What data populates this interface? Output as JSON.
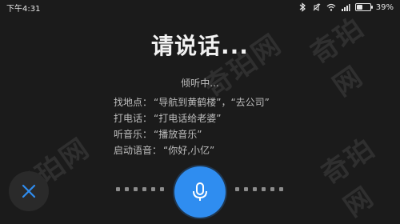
{
  "status_bar": {
    "time": "下午4:31",
    "battery": "39%"
  },
  "voice_prompt": {
    "title": "请说话...",
    "listening": "倾听中..."
  },
  "examples": [
    {
      "label": "找地点：",
      "value": "“导航到黄鹤楼”，“去公司”"
    },
    {
      "label": "打电话：",
      "value": "“打电话给老婆”"
    },
    {
      "label": "听音乐：",
      "value": "“播放音乐”"
    },
    {
      "label": "启动语音：",
      "value": "“你好,小亿”"
    }
  ],
  "watermarks": [
    "奇珀网",
    "奇珀网",
    "奇珀网",
    "奇珀网"
  ],
  "colors": {
    "background": "#1b1b1b",
    "accent": "#2f8df0",
    "close_accent": "#2f8df0"
  },
  "icons": {
    "mic": "microphone-icon",
    "close": "close-icon",
    "bluetooth": "bluetooth-icon",
    "mute": "mute-icon",
    "wifi": "wifi-icon",
    "signal": "signal-icon",
    "battery": "battery-icon"
  }
}
